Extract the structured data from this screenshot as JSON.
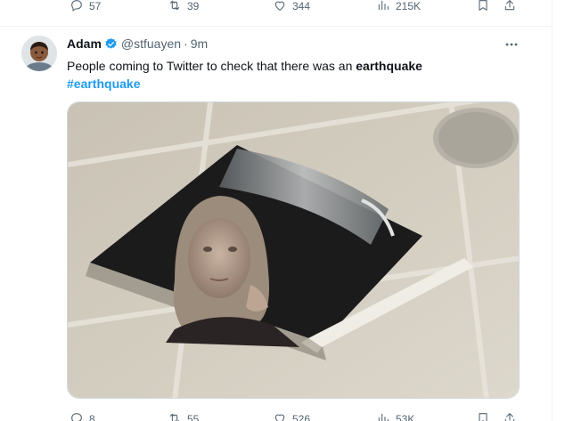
{
  "prev_tweet": {
    "replies": "57",
    "retweets": "39",
    "likes": "344",
    "views": "215K"
  },
  "tweet": {
    "author_name": "Adam",
    "handle": "@stfuayen",
    "separator": "·",
    "time": "9m",
    "text_before": "People coming to Twitter to check that there was an ",
    "text_bold": "earthquake",
    "hashtag": "#earthquake",
    "stats": {
      "replies": "8",
      "retweets": "55",
      "likes": "526",
      "views": "53K"
    }
  },
  "icons": {
    "reply": "reply-icon",
    "retweet": "retweet-icon",
    "like": "heart-icon",
    "views": "views-chart-icon",
    "bookmark": "bookmark-icon",
    "share": "share-icon",
    "verified": "verified-badge-icon",
    "more": "more-options-icon"
  },
  "colors": {
    "link": "#1d9bf0",
    "secondary_text": "#536471",
    "verified": "#1d9bf0"
  }
}
